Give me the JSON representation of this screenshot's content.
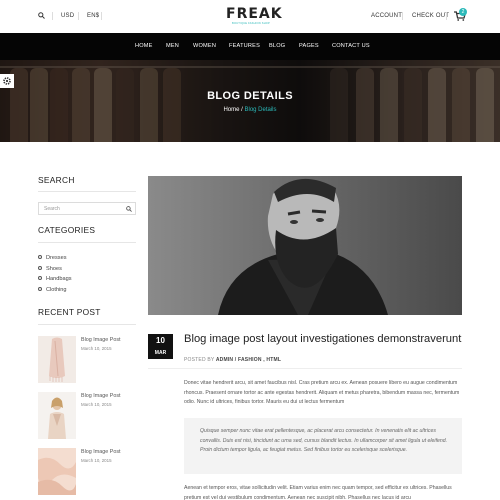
{
  "topbar": {
    "currency": "USD",
    "language": "EN$",
    "account": "ACCOUNT",
    "checkout": "CHECK OUT",
    "cart_count": "2"
  },
  "logo": {
    "main": "FREAK",
    "sub": "BOUTIQUE FASHION SHOP"
  },
  "nav": [
    "HOME",
    "MEN",
    "WOMEN",
    "FEATURES",
    "BLOG",
    "PAGES",
    "CONTACT US"
  ],
  "hero": {
    "title": "BLOG DETAILS",
    "crumb_home": "Home",
    "crumb_sep": " / ",
    "crumb_current": "Blog Details"
  },
  "sidebar": {
    "search_title": "SEARCH",
    "search_placeholder": "Search",
    "categories_title": "CATEGORIES",
    "categories": [
      "Dresses",
      "Shoes",
      "Handbags",
      "Clothing"
    ],
    "recent_title": "RECENT POST",
    "recent": [
      {
        "title": "Blog Image Post",
        "date": "March 10, 2015"
      },
      {
        "title": "Blog Image Post",
        "date": "March 10, 2015"
      },
      {
        "title": "Blog Image Post",
        "date": "March 10, 2015"
      }
    ]
  },
  "post": {
    "day": "10",
    "month": "MAR",
    "title": "Blog image post layout investigationes demonstraverunt",
    "meta_posted_by": "POSTED BY",
    "meta_author": "ADMIN",
    "meta_sep": " / ",
    "meta_tags": "FASHION , HTML",
    "para1": "Donec vitae hendrerit arcu, sit amet faucibus nisl. Cras pretium arcu ex. Aenean posuere libero eu augue condimentum rhoncus. Praesent ornare tortor ac ante egestas hendrerit. Aliquam et metus pharetra, bibendum massa nec, fermentum odio. Nunc id ultrices, finibus tortor. Mauris eu dui ut lectus fermentum",
    "quote": "Quisque semper nunc vitae erat pellentesque, ac placerat arcu consectetur. In venenatis elit ac ultrices convallis. Duis est nisi, tincidunt ac urna sed, cursus blandit lectus. In ullamcorper sit amet ligula ut eleifend. Proin dictum tempor ligula, ac feugiat metus. Sed finibus tortor eu scelerisque scelerisque.",
    "para2": "Aenean et tempor eros, vitae sollicitudin velit. Etiam varius enim nec quam tempor, sed efficitur ex ultrices. Phasellus pretium est vel dui vestibulum condimentum. Aenean nec suscipit nibh. Phasellus nec lacus id arcu"
  },
  "colors": {
    "accent": "#2bb9b9",
    "nav_bg": "#050505"
  },
  "icons": [
    "search-icon",
    "cart-icon",
    "gear-icon",
    "magnifier-icon"
  ]
}
